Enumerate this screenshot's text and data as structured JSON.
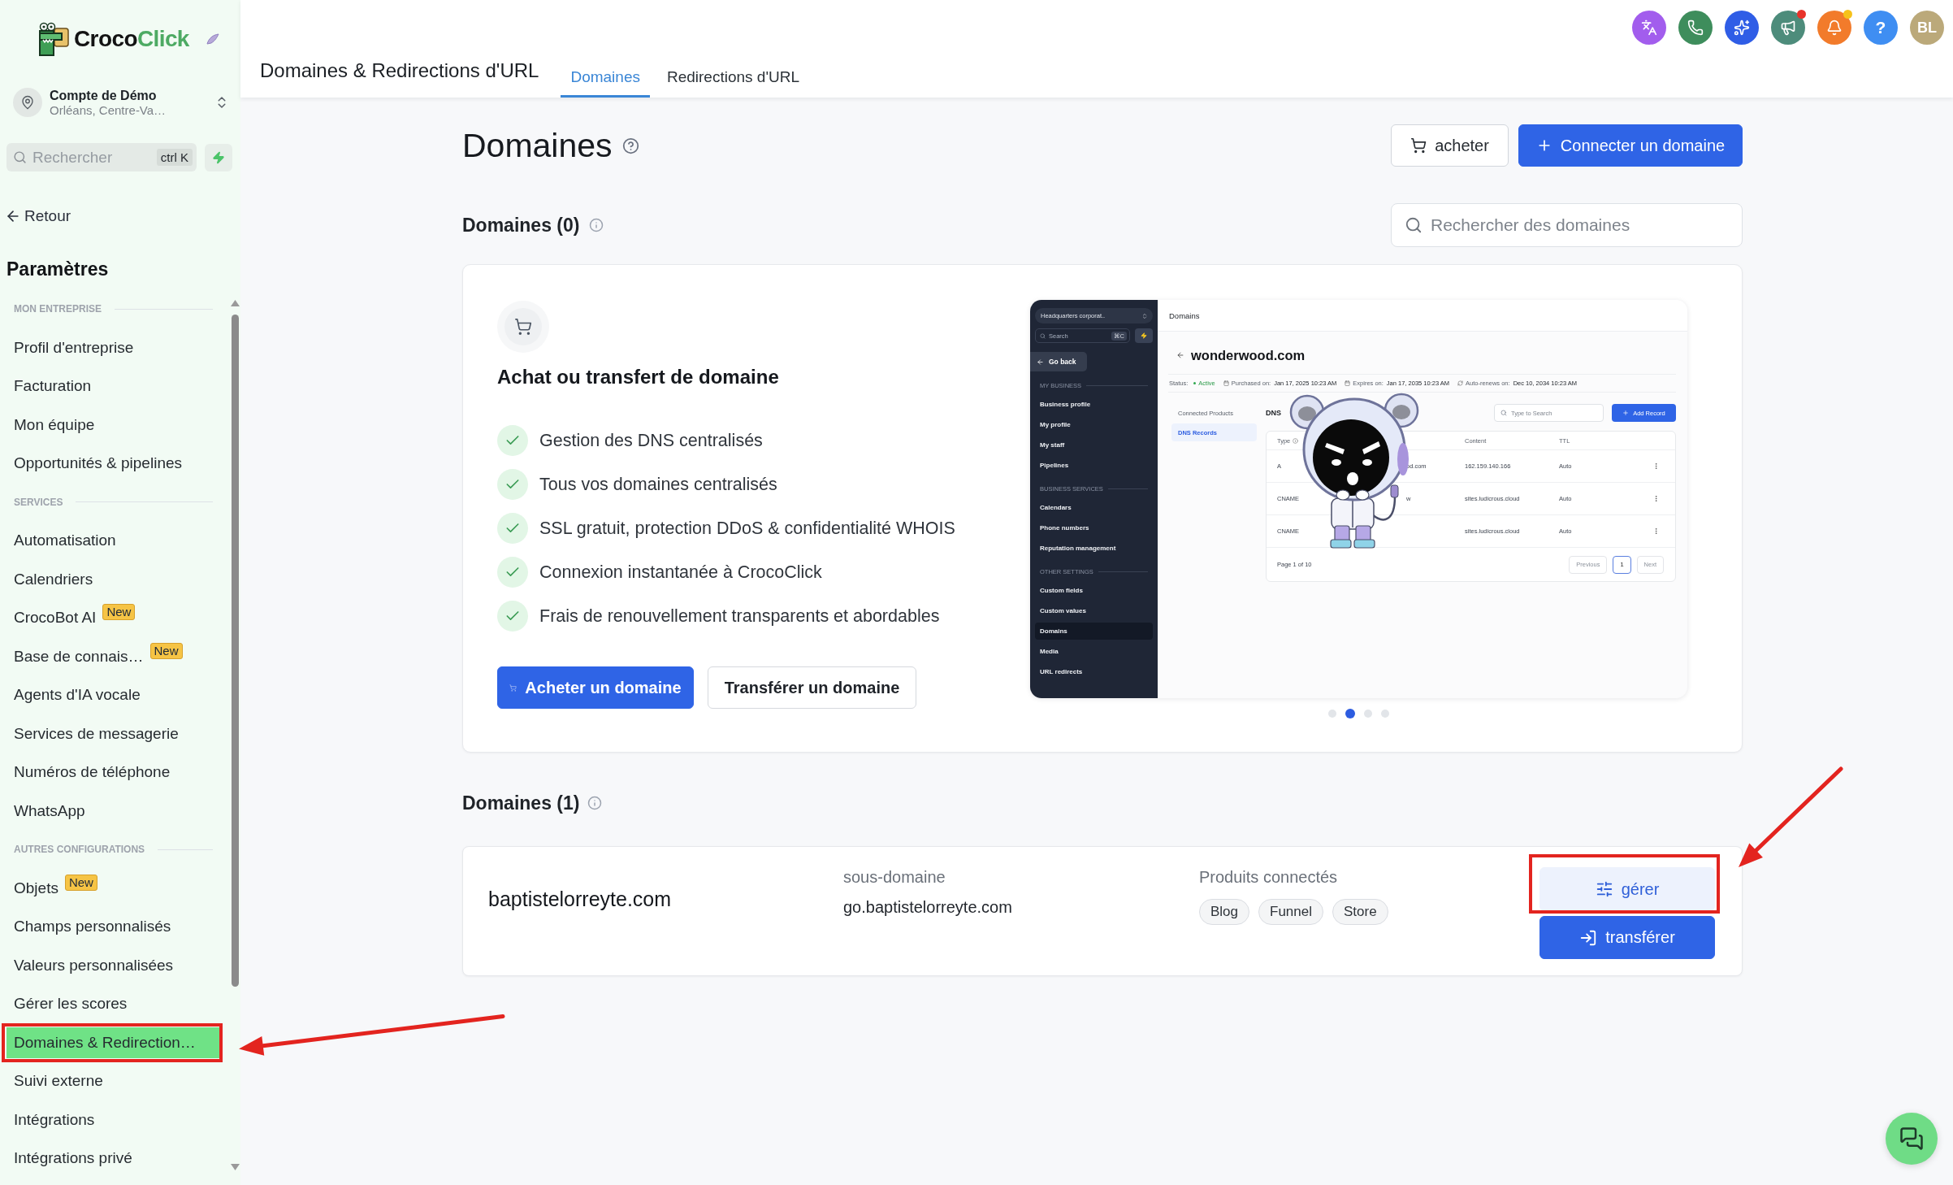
{
  "sidebar": {
    "logo": {
      "first": "Croco",
      "second": "Click"
    },
    "account": {
      "name": "Compte de Démo",
      "location": "Orléans, Centre-Va…"
    },
    "search": {
      "placeholder": "Rechercher",
      "shortcut": "ctrl K"
    },
    "back": "Retour",
    "title": "Paramètres",
    "sections": [
      {
        "heading": "MON ENTREPRISE",
        "items": [
          {
            "label": "Profil d'entreprise",
            "selected": false,
            "highlighted": false
          },
          {
            "label": "Facturation",
            "selected": false,
            "highlighted": false
          },
          {
            "label": "Mon équipe",
            "selected": false,
            "highlighted": false
          },
          {
            "label": "Opportunités & pipelines",
            "selected": false,
            "highlighted": false
          }
        ]
      },
      {
        "heading": "SERVICES",
        "items": [
          {
            "label": "Automatisation",
            "selected": false,
            "highlighted": false
          },
          {
            "label": "Calendriers",
            "selected": false,
            "highlighted": false
          },
          {
            "label": "CrocoBot AI",
            "badge": "New",
            "selected": false,
            "highlighted": false
          },
          {
            "label": "Base de connais…",
            "badge": "New",
            "selected": false,
            "highlighted": false
          },
          {
            "label": "Agents d'IA vocale",
            "selected": false,
            "highlighted": false
          },
          {
            "label": "Services de messagerie",
            "selected": false,
            "highlighted": false
          },
          {
            "label": "Numéros de téléphone",
            "selected": false,
            "highlighted": false
          },
          {
            "label": "WhatsApp",
            "selected": false,
            "highlighted": false
          }
        ]
      },
      {
        "heading": "AUTRES CONFIGURATIONS",
        "items": [
          {
            "label": "Objets",
            "badge": "New",
            "selected": false,
            "highlighted": false
          },
          {
            "label": "Champs personnalisés",
            "selected": false,
            "highlighted": false
          },
          {
            "label": "Valeurs personnalisées",
            "selected": false,
            "highlighted": false
          },
          {
            "label": "Gérer les scores",
            "selected": false,
            "highlighted": false
          },
          {
            "label": "Domaines & Redirection…",
            "selected": true,
            "highlighted": true
          },
          {
            "label": "Suivi externe",
            "selected": false,
            "highlighted": false
          },
          {
            "label": "Intégrations",
            "selected": false,
            "highlighted": false
          },
          {
            "label": "Intégrations privé",
            "selected": false,
            "highlighted": false
          }
        ]
      }
    ]
  },
  "header": {
    "shortcuts": [
      {
        "kind": "translate",
        "color": "#a25ded"
      },
      {
        "kind": "phone",
        "color": "#3e8d5c"
      },
      {
        "kind": "sparkle",
        "color": "#2f5de6"
      },
      {
        "kind": "megaphone",
        "color": "#4d8c7b",
        "dot": {
          "color": "#e8332a"
        }
      },
      {
        "kind": "bell",
        "color": "#f27b2b",
        "dot": {
          "color": "#f6c21b"
        }
      },
      {
        "kind": "help",
        "color": "#3f8ef2",
        "label": "?"
      },
      {
        "kind": "avatar",
        "color": "#bba97a",
        "label": "BL"
      }
    ],
    "title": "Domaines & Redirections d'URL",
    "tabs": [
      {
        "label": "Domaines",
        "selected": true
      },
      {
        "label": "Redirections d'URL",
        "selected": false
      }
    ]
  },
  "page": {
    "title": "Domaines",
    "actions": [
      {
        "kind": "buy",
        "label": "acheter"
      },
      {
        "kind": "connect",
        "label": "Connecter un domaine"
      }
    ],
    "available": {
      "heading": "Domaines (0)",
      "search": {
        "placeholder": "Rechercher des domaines"
      }
    },
    "promo": {
      "title": "Achat ou transfert de domaine",
      "features": [
        "Gestion des DNS centralisés",
        "Tous vos domaines centralisés",
        "SSL gratuit, protection DDoS & confidentialité WHOIS",
        "Connexion instantanée à CrocoClick",
        "Frais de renouvellement transparents et abordables"
      ],
      "buttons": [
        {
          "kind": "buy",
          "label": "Acheter un domaine"
        },
        {
          "kind": "transfer",
          "label": "Transférer un domaine"
        }
      ],
      "preview": {
        "sidebar": {
          "account": "Headquarters corporat..",
          "search": {
            "placeholder": "Search",
            "shortcut": "⌘C"
          },
          "back": "Go back",
          "sections": [
            {
              "heading": "MY BUSINESS",
              "items": [
                {
                  "label": "Business profile",
                  "selected": false
                },
                {
                  "label": "My profile",
                  "selected": false
                },
                {
                  "label": "My staff",
                  "selected": false
                },
                {
                  "label": "Pipelines",
                  "selected": false
                }
              ]
            },
            {
              "heading": "BUSINESS SERVICES",
              "items": [
                {
                  "label": "Calendars",
                  "selected": false
                },
                {
                  "label": "Phone numbers",
                  "selected": false
                },
                {
                  "label": "Reputation management",
                  "selected": false
                }
              ]
            },
            {
              "heading": "OTHER SETTINGS",
              "items": [
                {
                  "label": "Custom fields",
                  "selected": false
                },
                {
                  "label": "Custom values",
                  "selected": false
                },
                {
                  "label": "Domains",
                  "selected": true
                },
                {
                  "label": "Media",
                  "selected": false
                },
                {
                  "label": "URL redirects",
                  "selected": false
                }
              ]
            }
          ]
        },
        "topbar": "Domains",
        "domain": "wonderwood.com",
        "status": {
          "label": "Status:",
          "value": "Active"
        },
        "dates": [
          {
            "kind": "calendar",
            "label": "Purchased on:",
            "value": "Jan 17, 2025 10:23 AM"
          },
          {
            "kind": "calendar",
            "label": "Expires on:",
            "value": "Jan 17, 2035 10:23 AM"
          },
          {
            "kind": "renew",
            "label": "Auto-renews on:",
            "value": "Dec 10, 2034 10:23 AM"
          }
        ],
        "tabs": [
          {
            "label": "Connected Products",
            "selected": false
          },
          {
            "label": "DNS Records",
            "selected": true
          }
        ],
        "section_title": "DNS",
        "search": {
          "placeholder": "Type to Search"
        },
        "add_button": "Add Record",
        "columns": {
          "type": "Type",
          "content": "Content",
          "ttl": "TTL"
        },
        "rows": [
          {
            "type": "A",
            "name": "od.com",
            "content": "162.159.140.166",
            "ttl": "Auto"
          },
          {
            "type": "CNAME",
            "name": "w",
            "content": "sites.ludicrous.cloud",
            "ttl": "Auto"
          },
          {
            "type": "CNAME",
            "content": "sites.ludicrous.cloud",
            "ttl": "Auto"
          }
        ],
        "pagination": {
          "summary": "Page 1 of 10",
          "previous": {
            "label": "Previous",
            "disabled": true
          },
          "pages": [
            {
              "label": "1",
              "selected": true
            }
          ],
          "next": {
            "label": "Next",
            "disabled": true
          }
        }
      },
      "slides": [
        {
          "selected": false
        },
        {
          "selected": true
        },
        {
          "selected": false
        },
        {
          "selected": false
        }
      ]
    },
    "owned": {
      "heading": "Domaines (1)",
      "rows": [
        {
          "domain": "baptistelorreyte.com",
          "subdomain_label": "sous-domaine",
          "subdomain": "go.baptistelorreyte.com",
          "products_label": "Produits connectés",
          "products": [
            "Blog",
            "Funnel",
            "Store"
          ],
          "actions": [
            {
              "kind": "manage",
              "label": "gérer",
              "highlighted": true
            },
            {
              "kind": "transfer",
              "label": "transférer",
              "highlighted": false
            }
          ]
        }
      ]
    }
  }
}
